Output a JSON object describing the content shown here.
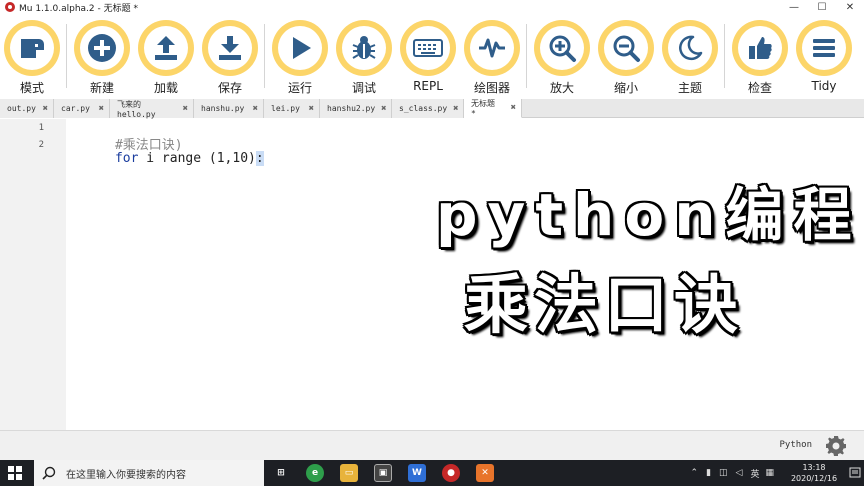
{
  "window": {
    "title": "Mu 1.1.0.alpha.2 - 无标题 *",
    "controls": [
      "—",
      "☐",
      "✕"
    ]
  },
  "toolbar": {
    "buttons": [
      {
        "label": "模式",
        "icon": "mode-icon"
      },
      {
        "label": "新建",
        "icon": "plus-icon"
      },
      {
        "label": "加载",
        "icon": "upload-icon"
      },
      {
        "label": "保存",
        "icon": "download-icon"
      },
      {
        "label": "运行",
        "icon": "play-icon"
      },
      {
        "label": "调试",
        "icon": "bug-icon"
      },
      {
        "label": "REPL",
        "icon": "keyboard-icon"
      },
      {
        "label": "绘图器",
        "icon": "waveform-icon"
      },
      {
        "label": "放大",
        "icon": "zoom-in-icon"
      },
      {
        "label": "缩小",
        "icon": "zoom-out-icon"
      },
      {
        "label": "主题",
        "icon": "moon-icon"
      },
      {
        "label": "检查",
        "icon": "thumbs-up-icon"
      },
      {
        "label": "Tidy",
        "icon": "menu-lines-icon"
      }
    ],
    "accent_color": "#fcd569",
    "icon_color": "#2f5d8a"
  },
  "tabs": [
    {
      "name": "out.py",
      "active": false
    },
    {
      "name": "car.py",
      "active": false
    },
    {
      "name": "飞来的hello.py",
      "active": false
    },
    {
      "name": "hanshu.py",
      "active": false
    },
    {
      "name": "lei.py",
      "active": false
    },
    {
      "name": "hanshu2.py",
      "active": false
    },
    {
      "name": "s_class.py",
      "active": false
    },
    {
      "name": "无标题 *",
      "active": true
    }
  ],
  "tab_close_glyph": "✖",
  "editor": {
    "line_numbers": [
      "1",
      "2"
    ],
    "line1": {
      "comment": "#乘法口诀)"
    },
    "line2": {
      "kw_for": "for",
      "rest": " i range (1,10)",
      "colon": ":"
    }
  },
  "overlay": {
    "line1": "python编程",
    "line2": "乘法口诀"
  },
  "statusbar": {
    "mode": "Python"
  },
  "taskbar": {
    "search_placeholder": "在这里输入你要搜索的内容",
    "tray_lang": "英",
    "time": "13:18",
    "date": "2020/12/16",
    "apps": [
      {
        "name": "task-view",
        "color": "#1d1f24",
        "glyph": "⊞"
      },
      {
        "name": "browser",
        "color": "#2e9e4b",
        "glyph": "e"
      },
      {
        "name": "file-explorer",
        "color": "#e8b33b",
        "glyph": "▭"
      },
      {
        "name": "mu-editor-taskbar",
        "color": "#444",
        "glyph": "▣"
      },
      {
        "name": "wps-writer",
        "color": "#2f6fd6",
        "glyph": "W"
      },
      {
        "name": "mu-app",
        "color": "#c62828",
        "glyph": "●"
      },
      {
        "name": "orange-app",
        "color": "#e8742b",
        "glyph": "✕"
      }
    ]
  }
}
